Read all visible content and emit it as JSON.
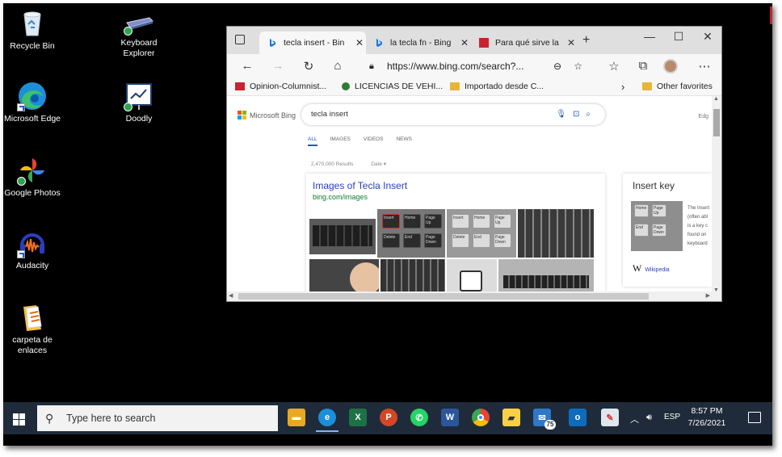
{
  "desktop": {
    "icons": [
      {
        "label": "Recycle Bin",
        "icon": "recycle-bin-icon"
      },
      {
        "label": "Keyboard Explorer",
        "icon": "keyboard-explorer-icon"
      },
      {
        "label": "Microsoft Edge",
        "icon": "edge-icon"
      },
      {
        "label": "Doodly",
        "icon": "doodly-icon"
      },
      {
        "label": "Google Photos",
        "icon": "google-photos-icon"
      },
      {
        "label": "Audacity",
        "icon": "audacity-icon"
      },
      {
        "label": "carpeta de enlaces",
        "icon": "folder-icon"
      }
    ]
  },
  "browser": {
    "tabs": [
      {
        "title": "tecla insert - Bin",
        "active": true
      },
      {
        "title": "la tecla fn - Bing",
        "active": false
      },
      {
        "title": "Para qué sirve la",
        "active": false
      }
    ],
    "new_tab": "+",
    "window_controls": {
      "minimize": "—",
      "maximize": "☐",
      "close": "✕"
    },
    "address": "https://www.bing.com/search?...",
    "favorites": [
      {
        "label": "Opinion-Columnist..."
      },
      {
        "label": "LICENCIAS DE VEHI..."
      },
      {
        "label": "Importado desde C..."
      }
    ],
    "favorites_more": "›",
    "other_favorites": "Other favorites",
    "bing": {
      "logo": "Microsoft Bing",
      "query": "tecla insert",
      "nav_tabs": [
        "ALL",
        "IMAGES",
        "VIDEOS",
        "NEWS"
      ],
      "results_count": "2,470,000 Results",
      "date_filter": "Date ▾",
      "images_title": "Images of Tecla Insert",
      "images_url": "bing.com/images",
      "sidebar_title": "Insert key",
      "sidebar_text": [
        "The Insert",
        "(often abl",
        "is a key c",
        "found on",
        "keyboard"
      ],
      "sidebar_source": "Wikipedia",
      "edge_clip": "Edg"
    }
  },
  "taskbar": {
    "search_placeholder": "Type here to search",
    "apps": [
      "file-explorer",
      "edge",
      "excel",
      "powerpoint",
      "whatsapp",
      "word",
      "chrome",
      "sticky-notes",
      "mail",
      "outlook",
      "paint"
    ],
    "mail_badge": "75",
    "language": "ESP",
    "time": "8:57 PM",
    "date": "7/26/2021"
  }
}
